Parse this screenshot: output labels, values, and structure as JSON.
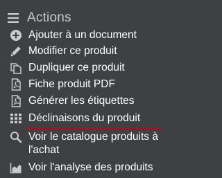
{
  "menu": {
    "title": "Actions",
    "title_icon": "menu-lines-icon",
    "items": [
      {
        "label": "Ajouter à un document",
        "icon": "plus-circle-icon"
      },
      {
        "label": "Modifier ce produit",
        "icon": "pencil-icon"
      },
      {
        "label": "Dupliquer ce produit",
        "icon": "copy-icon"
      },
      {
        "label": "Fiche produit PDF",
        "icon": "pdf-file-icon"
      },
      {
        "label": "Générer les étiquettes",
        "icon": "pdf-file-icon"
      },
      {
        "label": "Déclinaisons du produit",
        "icon": "grid-icon",
        "active": true
      },
      {
        "label": "Voir le catalogue produits à l'achat",
        "icon": "search-icon"
      },
      {
        "label": "Voir l'analyse des produits",
        "icon": "area-chart-icon"
      }
    ]
  },
  "colors": {
    "background": "#3f4042",
    "title": "#c5c7c9",
    "icon": "#c9cbce",
    "text": "#ffffff",
    "active_underline": "#d0021b"
  }
}
